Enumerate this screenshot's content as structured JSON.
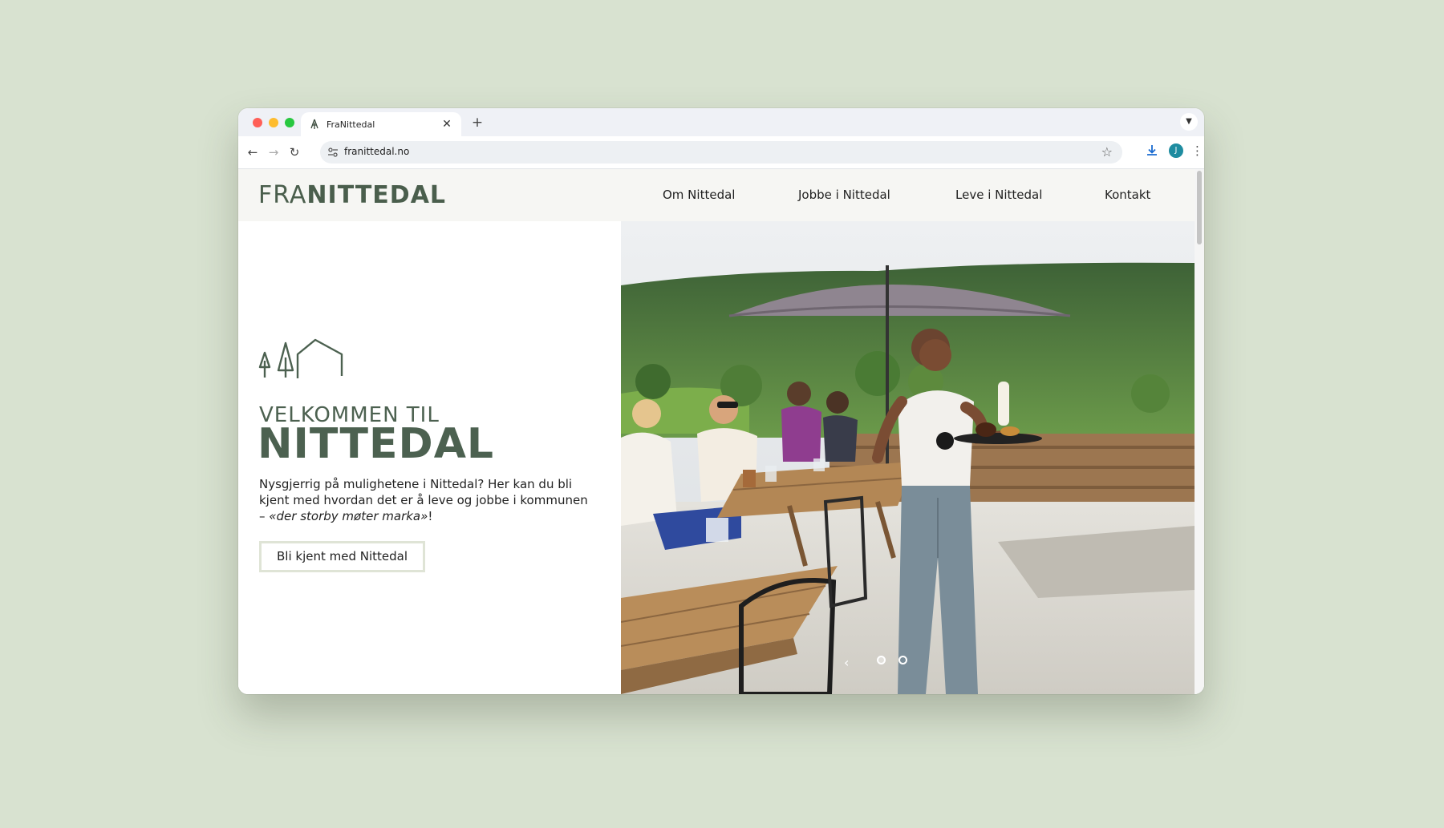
{
  "browser": {
    "tab_title": "FraNittedal",
    "url": "franittedal.no",
    "profile_initial": "J",
    "colors": {
      "close": "#ff5f57",
      "minimize": "#febc2e",
      "maximize": "#28c840"
    }
  },
  "site": {
    "logo_light": "FRA",
    "logo_bold": "NITTEDAL",
    "nav": [
      "Om Nittedal",
      "Jobbe i Nittedal",
      "Leve i Nittedal",
      "Kontakt"
    ],
    "hero": {
      "kicker": "VELKOMMEN TIL",
      "title": "NITTEDAL",
      "description": "Nysgjerrig på mulighetene i Nittedal? Her kan du bli kjent med hvordan det er å leve og jobbe i kommunen – ",
      "description_italic": "«der storby møter marka»",
      "description_end": "!",
      "cta": "Bli kjent med Nittedal"
    },
    "slider": {
      "slides": 2,
      "active": 1
    },
    "brand_color": "#4c6150"
  }
}
